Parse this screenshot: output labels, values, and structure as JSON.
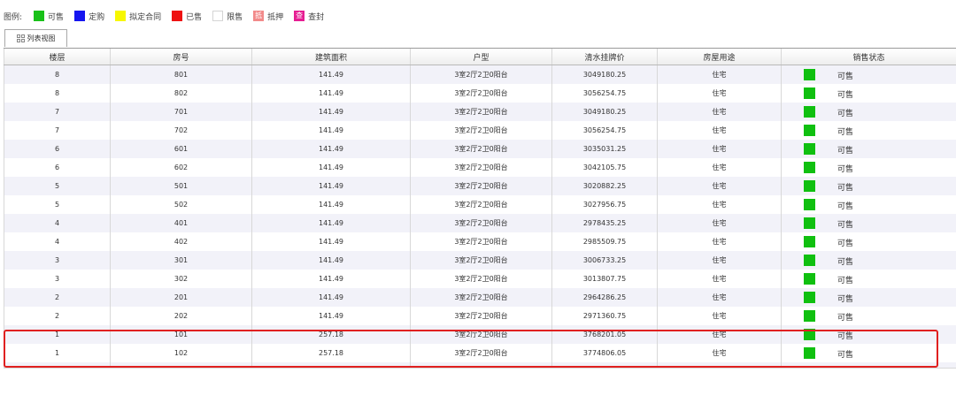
{
  "legend": {
    "title": "图例:",
    "items": [
      {
        "label": "可售",
        "color": "#19c119"
      },
      {
        "label": "定购",
        "color": "#1515f0"
      },
      {
        "label": "拟定合同",
        "color": "#f7f700"
      },
      {
        "label": "已售",
        "color": "#ee1111"
      },
      {
        "label": "限售",
        "color": "#ffffff"
      },
      {
        "label": "抵押",
        "color": "#f28a8a",
        "glyph": "抵"
      },
      {
        "label": "查封",
        "color": "#e61d92",
        "glyph": "查"
      }
    ]
  },
  "tab": {
    "label": "列表视图"
  },
  "table": {
    "columns": [
      "楼层",
      "房号",
      "建筑面积",
      "户型",
      "清水挂牌价",
      "房屋用途",
      "销售状态"
    ],
    "rows": [
      [
        "8",
        "801",
        "141.49",
        "3室2厅2卫0阳台",
        "3049180.25",
        "住宅",
        "可售"
      ],
      [
        "8",
        "802",
        "141.49",
        "3室2厅2卫0阳台",
        "3056254.75",
        "住宅",
        "可售"
      ],
      [
        "7",
        "701",
        "141.49",
        "3室2厅2卫0阳台",
        "3049180.25",
        "住宅",
        "可售"
      ],
      [
        "7",
        "702",
        "141.49",
        "3室2厅2卫0阳台",
        "3056254.75",
        "住宅",
        "可售"
      ],
      [
        "6",
        "601",
        "141.49",
        "3室2厅2卫0阳台",
        "3035031.25",
        "住宅",
        "可售"
      ],
      [
        "6",
        "602",
        "141.49",
        "3室2厅2卫0阳台",
        "3042105.75",
        "住宅",
        "可售"
      ],
      [
        "5",
        "501",
        "141.49",
        "3室2厅2卫0阳台",
        "3020882.25",
        "住宅",
        "可售"
      ],
      [
        "5",
        "502",
        "141.49",
        "3室2厅2卫0阳台",
        "3027956.75",
        "住宅",
        "可售"
      ],
      [
        "4",
        "401",
        "141.49",
        "3室2厅2卫0阳台",
        "2978435.25",
        "住宅",
        "可售"
      ],
      [
        "4",
        "402",
        "141.49",
        "3室2厅2卫0阳台",
        "2985509.75",
        "住宅",
        "可售"
      ],
      [
        "3",
        "301",
        "141.49",
        "3室2厅2卫0阳台",
        "3006733.25",
        "住宅",
        "可售"
      ],
      [
        "3",
        "302",
        "141.49",
        "3室2厅2卫0阳台",
        "3013807.75",
        "住宅",
        "可售"
      ],
      [
        "2",
        "201",
        "141.49",
        "3室2厅2卫0阳台",
        "2964286.25",
        "住宅",
        "可售"
      ],
      [
        "2",
        "202",
        "141.49",
        "3室2厅2卫0阳台",
        "2971360.75",
        "住宅",
        "可售"
      ],
      [
        "1",
        "101",
        "257.18",
        "3室2厅2卫0阳台",
        "3768201.05",
        "住宅",
        "可售"
      ],
      [
        "1",
        "102",
        "257.18",
        "3室2厅2卫0阳台",
        "3774806.05",
        "住宅",
        "可售"
      ]
    ],
    "status_color": "#10c010",
    "highlight_color": "#e02020"
  }
}
